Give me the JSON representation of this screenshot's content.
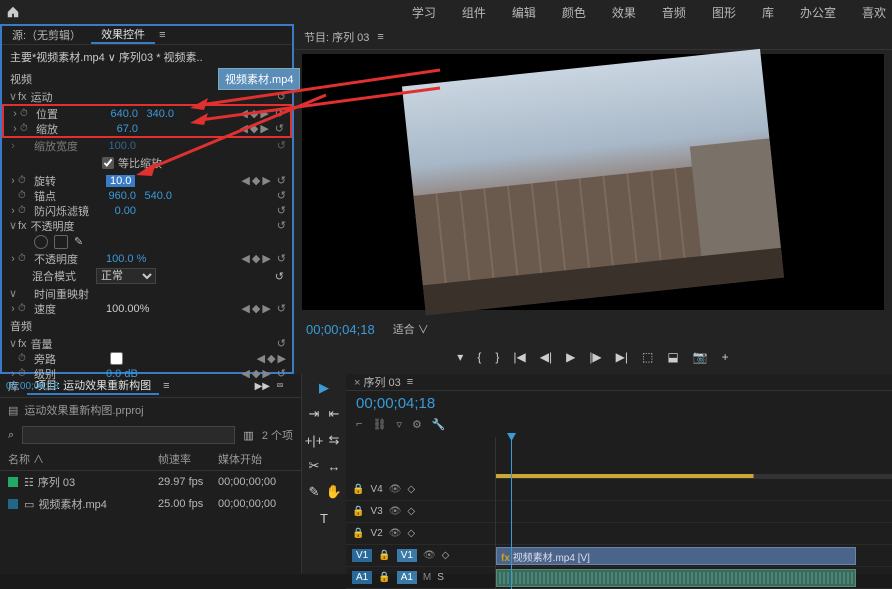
{
  "topbar": {
    "workspaces": [
      "学习",
      "组件",
      "编辑",
      "颜色",
      "效果",
      "音频",
      "图形",
      "库",
      "办公室",
      "喜欢"
    ]
  },
  "source_panel": {
    "tab_source": "源:（无剪辑）",
    "tab_effects": "效果控件",
    "breadcrumb": "主要*视频素材.mp4 ∨ 序列03 * 视频素..",
    "section_video": "视频",
    "fx_motion": "运动",
    "tooltip": "视频素材.mp4",
    "position": {
      "label": "位置",
      "x": "640.0",
      "y": "340.0"
    },
    "scale": {
      "label": "缩放",
      "val": "67.0"
    },
    "scale_w": {
      "label": "缩放宽度",
      "val": "100.0"
    },
    "uniform_scale": "等比缩放",
    "rotation": {
      "label": "旋转",
      "val": "10.0"
    },
    "anchor": {
      "label": "锚点",
      "x": "960.0",
      "y": "540.0"
    },
    "antiflicker": {
      "label": "防闪烁滤镜",
      "val": "0.00"
    },
    "fx_opacity": "不透明度",
    "opacity": {
      "label": "不透明度",
      "val": "100.0 %"
    },
    "blend": {
      "label": "混合模式",
      "val": "正常"
    },
    "fx_timeremap": "时间重映射",
    "speed": {
      "label": "速度",
      "val": "100.00%"
    },
    "section_audio": "音频",
    "fx_volume": "音量",
    "bypass": "旁路",
    "level": {
      "label": "级别",
      "val": "0.0 dB"
    },
    "tc": "00;00;04;18"
  },
  "program": {
    "tab": "节目: 序列 03",
    "tc": "00;00;04;18",
    "fit": "适合"
  },
  "project": {
    "tab_lib": "库",
    "tab_project": "项目: 运动效果重新构图",
    "filename": "运动效果重新构图.prproj",
    "count": "2 个项",
    "col_name": "名称",
    "col_fps": "帧速率",
    "col_start": "媒体开始",
    "items": [
      {
        "name": "序列 03",
        "fps": "29.97 fps",
        "start": "00;00;00;00"
      },
      {
        "name": "视频素材.mp4",
        "fps": "25.00 fps",
        "start": "00;00;00;00"
      }
    ]
  },
  "timeline": {
    "tab": "序列 03",
    "tc": "00;00;04;18",
    "tracks": {
      "v4": "V4",
      "v3": "V3",
      "v2": "V2",
      "v1_src": "V1",
      "v1": "V1",
      "a1_src": "A1",
      "a1": "A1"
    },
    "clip_v": "视频素材.mp4 [V]",
    "fx": "fx"
  }
}
